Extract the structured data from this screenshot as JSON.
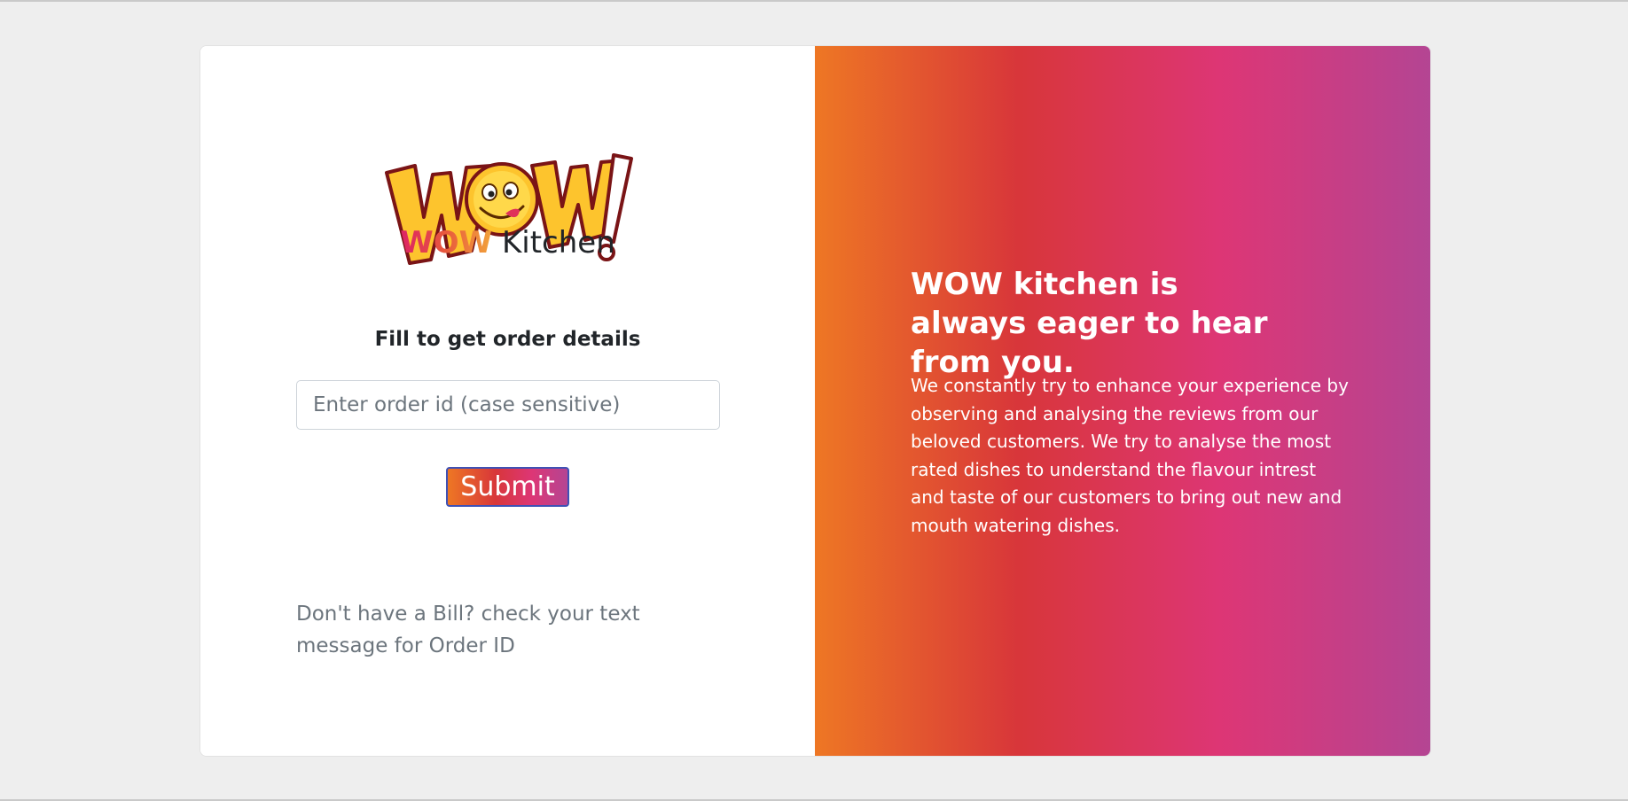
{
  "logo": {
    "icon": "wow-smiley-logo-icon"
  },
  "brand": {
    "wow": "WOW",
    "kitchen": "Kitchen"
  },
  "form": {
    "title": "Fill to get order details",
    "order_id_placeholder": "Enter order id (case sensitive)",
    "order_id_value": "",
    "submit_label": "Submit"
  },
  "note": {
    "text": "Don't have a Bill? check your text message for Order ID"
  },
  "promo": {
    "headline": "WOW kitchen is always eager to hear from you.",
    "paragraph": "We constantly try to enhance your experience by observing and analysing the reviews from our beloved customers. We try to analyse the most rated dishes to understand the flavour intrest and taste of our customers to bring out new and mouth watering dishes."
  },
  "colors": {
    "gradient_start": "#ee7724",
    "gradient_mid1": "#d8363a",
    "gradient_mid2": "#dd3675",
    "gradient_end": "#b44593",
    "logo_yellow": "#fdc42d",
    "logo_outline": "#7a1416"
  }
}
